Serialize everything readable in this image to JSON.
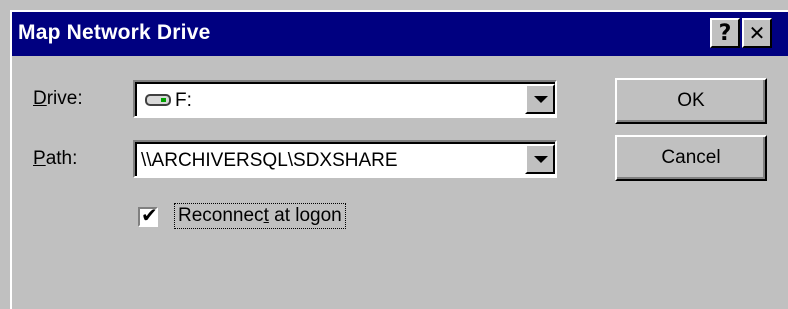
{
  "window": {
    "title": "Map Network Drive",
    "help_glyph": "?",
    "close_glyph": "✕"
  },
  "form": {
    "drive_label_accel": "D",
    "drive_label_rest": "rive:",
    "drive_value": "F:",
    "path_label_accel": "P",
    "path_label_rest": "ath:",
    "path_value": "\\\\ARCHIVERSQL\\SDXSHARE"
  },
  "reconnect": {
    "checked": true,
    "check_glyph": "✔",
    "label_before": "Reconnec",
    "label_accel": "t",
    "label_after": " at logon"
  },
  "buttons": {
    "ok": "OK",
    "cancel": "Cancel"
  },
  "colors": {
    "titlebar": "#000080",
    "dialog_face": "#c0c0c0"
  },
  "icons": {
    "drive": "network-drive-icon",
    "dropdown": "chevron-down-icon"
  }
}
